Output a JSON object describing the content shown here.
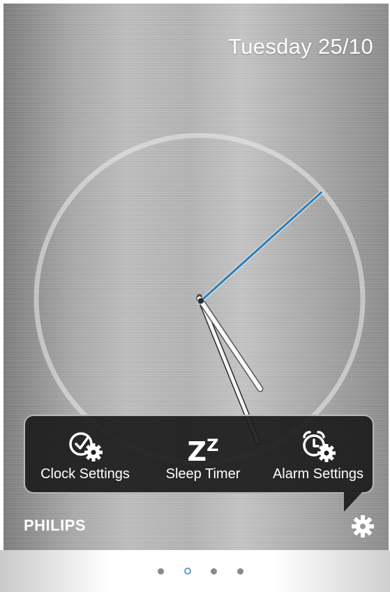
{
  "header": {
    "date": "Tuesday 25/10"
  },
  "clock": {
    "hour_hand_angle_deg": 146,
    "minute_hand_angle_deg": 158,
    "second_hand_angle_deg": 48,
    "second_hand_color": "#2a7fb8"
  },
  "menu": {
    "items": [
      {
        "label": "Clock Settings",
        "icon": "clock-settings-icon"
      },
      {
        "label": "Sleep Timer",
        "icon": "sleep-zz-icon",
        "glyph": "Z"
      },
      {
        "label": "Alarm Settings",
        "icon": "alarm-settings-icon"
      }
    ]
  },
  "footer": {
    "brand": "PHILIPS",
    "settings_icon": "gear-icon"
  },
  "pager": {
    "count": 4,
    "active_index": 1,
    "accent": "#5a9fd4"
  }
}
